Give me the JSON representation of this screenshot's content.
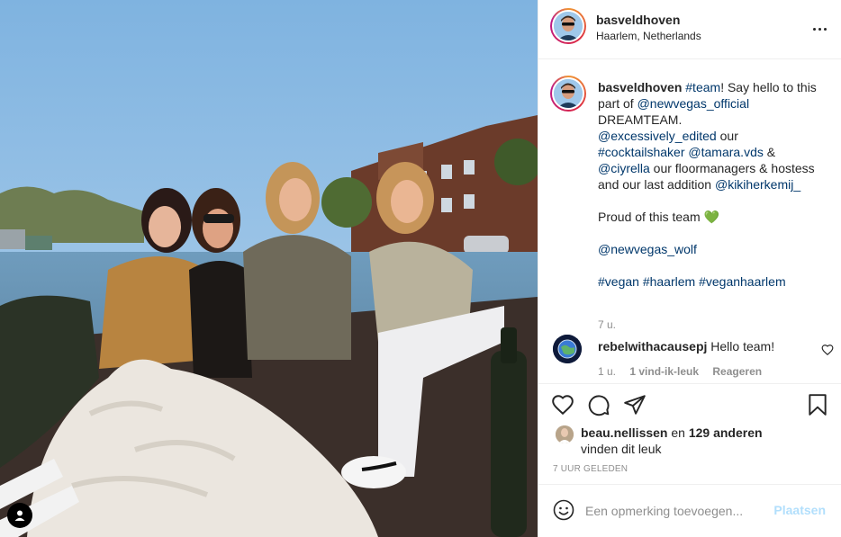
{
  "post": {
    "username": "basveldhoven",
    "location": "Haarlem, Netherlands"
  },
  "caption": {
    "username": "basveldhoven",
    "segments": [
      {
        "text": " ",
        "type": "text"
      },
      {
        "text": "#team",
        "type": "link"
      },
      {
        "text": "! Say hello to this part of ",
        "type": "text"
      },
      {
        "text": "@newvegas_official",
        "type": "link"
      },
      {
        "text": " DREAMTEAM.\n",
        "type": "text"
      },
      {
        "text": "@excessively_edited",
        "type": "link"
      },
      {
        "text": " our\n",
        "type": "text"
      },
      {
        "text": "#cocktailshaker",
        "type": "link"
      },
      {
        "text": " ",
        "type": "text"
      },
      {
        "text": "@tamara.vds",
        "type": "link"
      },
      {
        "text": " &\n",
        "type": "text"
      },
      {
        "text": "@ciyrella",
        "type": "link"
      },
      {
        "text": " our floormanagers & hostess and our last addition ",
        "type": "text"
      },
      {
        "text": "@kikiherkemij_",
        "type": "link"
      },
      {
        "text": "\n\nProud of this team 💚\n\n",
        "type": "text"
      },
      {
        "text": "@newvegas_wolf",
        "type": "link"
      },
      {
        "text": "\n\n",
        "type": "text"
      },
      {
        "text": "#vegan",
        "type": "link"
      },
      {
        "text": " ",
        "type": "text"
      },
      {
        "text": "#haarlem",
        "type": "link"
      },
      {
        "text": " ",
        "type": "text"
      },
      {
        "text": "#veganhaarlem",
        "type": "link"
      }
    ],
    "time": "7 u."
  },
  "comment": {
    "username": "rebelwithacausepj",
    "text": "Hello team!",
    "time": "1 u.",
    "likes": "1 vind-ik-leuk",
    "reply": "Reageren"
  },
  "likes": {
    "user": "beau.nellissen",
    "connector": "en",
    "others": "129 anderen",
    "suffix": "vinden dit leuk"
  },
  "timestamp": "7 UUR GELEDEN",
  "add_comment": {
    "placeholder": "Een opmerking toevoegen...",
    "post_label": "Plaatsen"
  },
  "icons": {
    "like": "heart-icon",
    "comment": "comment-bubble-icon",
    "share": "paper-plane-icon",
    "save": "bookmark-icon",
    "emoji": "smiley-icon",
    "more": "ellipsis-icon",
    "user_tag": "user-tag-icon"
  },
  "colors": {
    "link": "#00376b",
    "muted": "#8e8e8e",
    "post_button": "#b2dffc",
    "border": "#efefef"
  }
}
